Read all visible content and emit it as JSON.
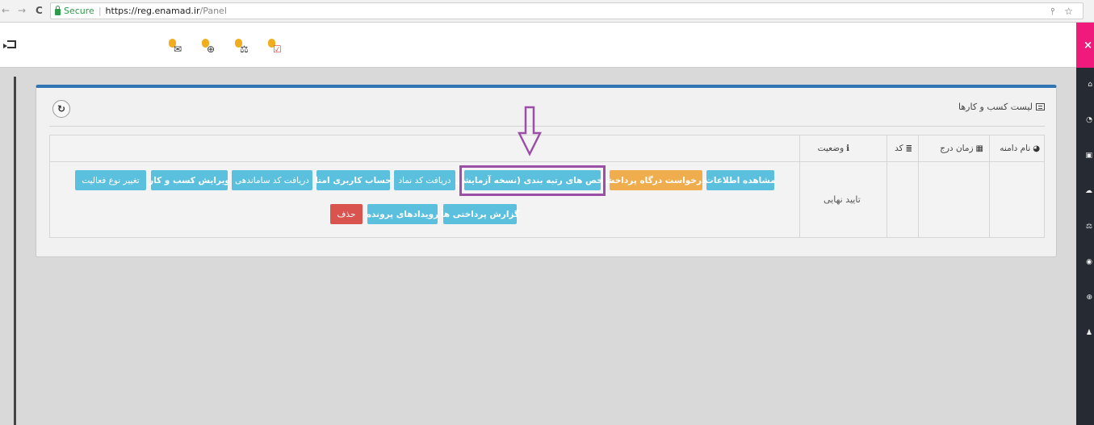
{
  "browser": {
    "nav_back": "←",
    "nav_forward": "→",
    "nav_reload": "C",
    "secure_label": "Secure",
    "url_host": "https://reg.enamad.ir",
    "url_path": "/Panel",
    "addr_icons": "⫯ ☆"
  },
  "topbar": {
    "icons": [
      "envelope-icon",
      "lifebuoy-icon",
      "scale-icon",
      "calendar-icon"
    ],
    "glyphs": [
      "✉",
      "⊕",
      "⚖",
      "☑"
    ]
  },
  "sidebar": {
    "close_label": "×",
    "items": [
      "home-icon",
      "dashboard-icon",
      "id-card-icon",
      "cloud-icon",
      "scale-icon",
      "eye-icon",
      "support-icon",
      "user-icon"
    ],
    "glyphs": [
      "⌂",
      "◔",
      "▣",
      "☁",
      "⚖",
      "◉",
      "⊕",
      "♟"
    ]
  },
  "panel": {
    "title": "لیست کسب و کارها",
    "refresh_label": "↻"
  },
  "table": {
    "headers": {
      "domain": "نام دامنه",
      "date": "زمان درج",
      "code": "کد",
      "status": "وضعیت"
    },
    "row": {
      "status": "تایید نهایی"
    }
  },
  "actions": {
    "view_info": "مشاهده اطلاعات",
    "gateway_request": "درخواست درگاه پرداخت",
    "ranking_index": "شاخص های رتبه بندی (نسخه آزمایشی)",
    "get_namad": "دریافت کد نماد",
    "amta_account": "حساب کاربری امتا",
    "get_samandehi": "دریافت کد ساماندهی",
    "edit_business": "ویرایش کسب و کار",
    "change_activity": "تغییر نوع فعالیت",
    "payment_reports": "گزارش پرداختی ها",
    "case_events": "رویدادهای پرونده",
    "delete": "حذف"
  },
  "colors": {
    "panel_border": "#2f74b5",
    "info": "#5bc0de",
    "warning": "#f0ad4e",
    "danger": "#d9534f",
    "highlight": "#9b4fa6",
    "sidebar_close": "#ef1a7c"
  }
}
